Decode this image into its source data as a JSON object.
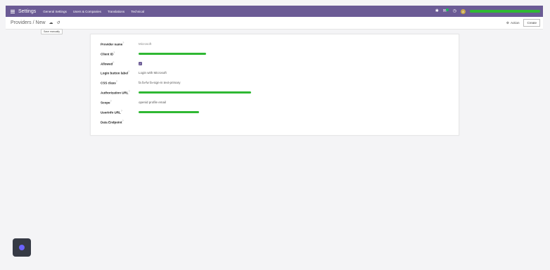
{
  "navbar": {
    "app_name": "Settings",
    "menu": [
      "General Settings",
      "Users & Companies",
      "Translations",
      "Technical"
    ]
  },
  "control_panel": {
    "breadcrumb_parent": "Providers",
    "breadcrumb_sep": "/",
    "breadcrumb_current": "New",
    "save_tooltip": "Save manually",
    "action_label": "Action",
    "create_label": "Create"
  },
  "form": {
    "fields": {
      "provider_name": {
        "label": "Provider name",
        "value": "Microsoft"
      },
      "client_id": {
        "label": "Client ID"
      },
      "allowed": {
        "label": "Allowed",
        "checked": true
      },
      "login_button_label": {
        "label": "Login button label",
        "value": "Login with Microsoft"
      },
      "css_class": {
        "label": "CSS class",
        "value": "fa fa-fw fa-sign-in text-primary"
      },
      "authorization_url": {
        "label": "Authorization URL"
      },
      "scope": {
        "label": "Scope",
        "value": "openid profile email"
      },
      "userinfo_url": {
        "label": "UserInfo URL"
      },
      "data_endpoint": {
        "label": "Data Endpoint"
      }
    },
    "required_marker": "?"
  },
  "colors": {
    "brand": "#6b5b95",
    "redaction": "#2fb833"
  }
}
